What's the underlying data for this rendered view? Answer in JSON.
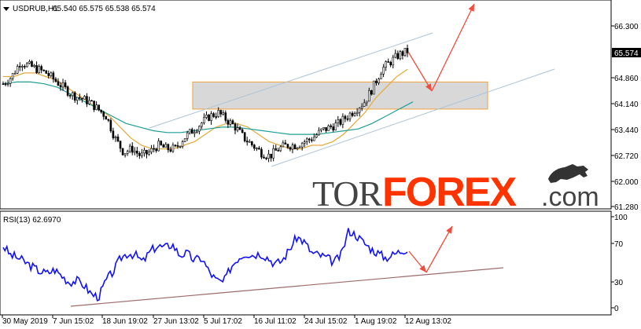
{
  "price_panel": {
    "symbol_header": "USDRUB,H1",
    "ohlc": "65.540 65.575 65.538 65.574",
    "current_price_label": "65.574",
    "y_ticks": [
      "66.300",
      "65.580",
      "64.860",
      "64.140",
      "63.440",
      "62.720",
      "62.000",
      "61.280"
    ]
  },
  "rsi_panel": {
    "header": "RSI(13) 62.6970",
    "y_ticks": [
      "100",
      "70",
      "30",
      "0"
    ]
  },
  "x_ticks": [
    "30 May 2019",
    "7 Jun 15:02",
    "18 Jun 19:02",
    "27 Jun 13:02",
    "5 Jul 17:02",
    "16 Jul 11:02",
    "24 Jul 15:02",
    "1 Aug 19:02",
    "12 Aug 13:02"
  ],
  "watermark": {
    "part1": "TOR",
    "part2": "FOREX",
    "part3": ".com"
  },
  "colors": {
    "candle": "#000000",
    "ma_fast": "#e6a93a",
    "ma_slow": "#1f9e96",
    "channel": "#a9c3d9",
    "zone_border": "#f0a23c",
    "zone_fill": "#d8d8d8",
    "arrow": "#f04b3c",
    "rsi_line": "#1010ff",
    "rsi_trendline": "#9e6a6a",
    "wm_dark": "#444444",
    "wm_red": "#ff3300"
  },
  "chart_data": [
    {
      "type": "candlestick",
      "title": "USDRUB,H1",
      "x_range": [
        "30 May 2019",
        "12 Aug 13:02"
      ],
      "ylim": [
        61.28,
        66.3
      ],
      "series": [
        {
          "values": [
            64.7,
            64.9,
            65.3,
            65.2,
            65.1,
            65.0,
            64.8,
            64.6,
            64.4,
            64.3,
            64.2,
            64.0,
            63.8,
            63.2,
            62.8,
            62.9,
            62.7,
            62.8,
            63.0,
            62.9,
            62.9,
            63.2,
            63.4,
            63.6,
            63.8,
            63.9,
            63.7,
            63.5,
            63.2,
            63.0,
            62.8,
            62.7,
            62.9,
            63.0,
            63.0,
            63.1,
            63.2,
            63.4,
            63.5,
            63.6,
            63.8,
            64.0,
            64.2,
            64.6,
            65.1,
            65.3,
            65.5,
            65.6
          ],
          "close": 65.574
        },
        {
          "name": "",
          "kind": "moving-average-fast",
          "values": [
            64.9,
            64.9,
            65.0,
            65.0,
            64.9,
            64.8,
            64.6,
            64.4,
            64.2,
            64.0,
            63.8,
            63.5,
            63.2,
            63.0,
            62.9,
            62.9,
            62.9,
            63.0,
            63.1,
            63.3,
            63.5,
            63.6,
            63.6,
            63.5,
            63.3,
            63.1,
            63.0,
            62.9,
            62.9,
            63.0,
            63.0,
            63.1,
            63.3,
            63.6,
            63.9,
            64.3,
            64.6,
            64.9,
            65.1
          ]
        },
        {
          "name": "",
          "kind": "moving-average-slow",
          "values": [
            64.7,
            64.75,
            64.75,
            64.7,
            64.6,
            64.4,
            64.2,
            64.0,
            63.8,
            63.6,
            63.5,
            63.4,
            63.35,
            63.35,
            63.4,
            63.45,
            63.5,
            63.5,
            63.45,
            63.4,
            63.35,
            63.3,
            63.3,
            63.3,
            63.35,
            63.4,
            63.45,
            63.6,
            63.8,
            64.0,
            64.2
          ]
        }
      ],
      "annotations": [
        "ascending channel",
        "support zone 64.00-64.75",
        "projection arrows"
      ]
    },
    {
      "type": "line",
      "title": "RSI(13) 62.6970",
      "ylim": [
        0,
        100
      ],
      "series": [
        {
          "values": [
            68,
            58,
            55,
            50,
            45,
            40,
            38,
            42,
            35,
            28,
            30,
            25,
            15,
            12,
            30,
            40,
            55,
            60,
            58,
            50,
            62,
            68,
            66,
            70,
            58,
            60,
            52,
            55,
            40,
            30,
            28,
            45,
            55,
            60,
            58,
            60,
            55,
            48,
            52,
            65,
            78,
            72,
            60,
            58,
            55,
            50,
            58,
            85,
            80,
            72,
            65,
            60,
            55,
            58,
            62,
            65
          ],
          "last": 62.697
        }
      ]
    }
  ]
}
